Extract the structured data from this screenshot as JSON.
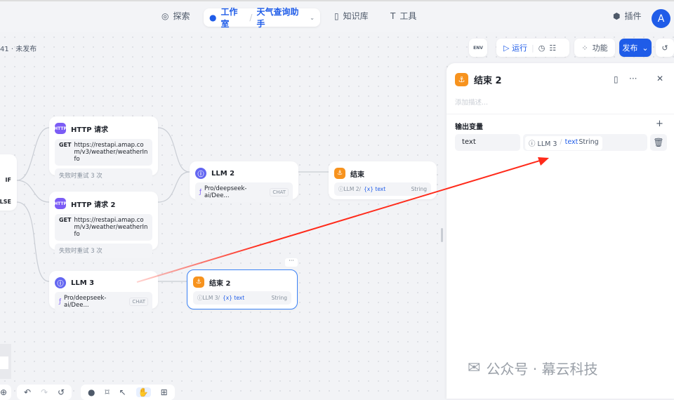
{
  "nav": {
    "explore": "探索",
    "studio": "工作室",
    "app_name": "天气查询助手",
    "knowledge": "知识库",
    "tools": "工具",
    "plugins": "插件",
    "avatar": "A"
  },
  "status": "41 · 未发布",
  "toolbar": {
    "env": "ENV",
    "run": "运行",
    "features": "功能",
    "publish": "发布"
  },
  "nodes": {
    "condition": {
      "if": "IF",
      "else": "ELSE"
    },
    "http1": {
      "title": "HTTP 请求",
      "method": "GET",
      "url": "https://restapi.amap.com/v3/weather/weatherInfo",
      "retry": "失败时重试 3 次",
      "badge": "HTTP"
    },
    "http2": {
      "title": "HTTP 请求 2",
      "method": "GET",
      "url": "https://restapi.amap.com/v3/weather/weatherInfo",
      "retry": "失败时重试 3 次",
      "badge": "HTTP"
    },
    "llm2": {
      "title": "LLM 2",
      "model": "Pro/deepseek-ai/Dee...",
      "tag": "CHAT"
    },
    "end1": {
      "title": "结束",
      "source": "LLM 2",
      "sep": "/",
      "var": "{x} text",
      "type": "String"
    },
    "llm3": {
      "title": "LLM 3",
      "model": "Pro/deepseek-ai/Dee...",
      "tag": "CHAT"
    },
    "end2": {
      "title": "结束 2",
      "source": "LLM 3",
      "sep": "/",
      "var": "{x} text",
      "type": "String"
    }
  },
  "panel": {
    "title": "结束 2",
    "description_placeholder": "添加描述...",
    "section": "输出变量",
    "var_name": "text",
    "ref_source": "LLM 3",
    "ref_sep": "/",
    "ref_var": "text",
    "ref_type": "String"
  },
  "watermark": "公众号 · 幕云科技",
  "colors": {
    "accent": "#1f5ce8",
    "annotation": "#ff2a1a",
    "end": "#f7931e",
    "llm": "#6366f1",
    "http": "#7b5cf5"
  }
}
